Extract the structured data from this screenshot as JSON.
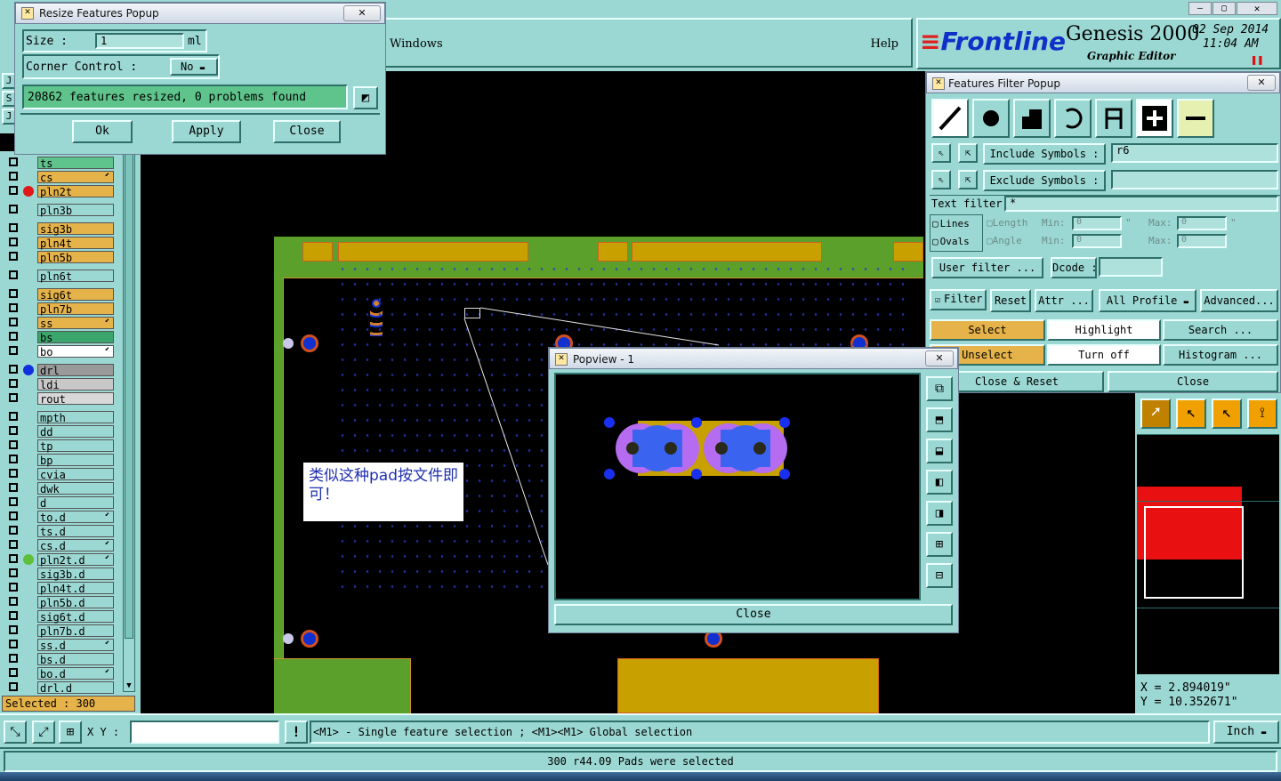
{
  "resize_popup": {
    "title": "Resize Features Popup",
    "size_label": "Size :",
    "size_value": "1",
    "size_unit": "ml",
    "corner_label": "Corner Control :",
    "corner_value": "No",
    "status": "20862 features resized, 0 problems found",
    "ok": "Ok",
    "apply": "Apply",
    "close": "Close"
  },
  "menu": {
    "windows": "Windows",
    "help": "Help"
  },
  "branding": {
    "logo": "Frontline",
    "product": "Genesis 2000",
    "subtitle": "Graphic Editor",
    "date": "02 Sep 2014",
    "time": "11:04 AM"
  },
  "filter_popup": {
    "title": "Features Filter Popup",
    "include_label": "Include Symbols :",
    "include_value": "r6",
    "exclude_label": "Exclude Symbols :",
    "exclude_value": "",
    "text_filter_label": "Text filter",
    "text_filter_value": "*",
    "lines": "Lines",
    "ovals": "Ovals",
    "length": "Length",
    "angle": "Angle",
    "min": "Min:",
    "max": "Max:",
    "len_min": "0",
    "len_max": "0",
    "ang_min": "0",
    "ang_max": "0",
    "quote": "\"",
    "user_filter": "User filter ...",
    "dcode": "Dcode :",
    "filter": "Filter",
    "reset": "Reset",
    "attr": "Attr ...",
    "all_profile": "All Profile",
    "advanced": "Advanced...",
    "select": "Select",
    "highlight": "Highlight",
    "search": "Search ...",
    "unselect": "Unselect",
    "turn_off": "Turn off",
    "histogram": "Histogram ...",
    "close_reset": "Close & Reset",
    "close": "Close"
  },
  "popview": {
    "title": "Popview - 1",
    "close": "Close"
  },
  "annotation": "类似这种pad按文件即可！",
  "layers": [
    {
      "name": "ts",
      "color": "#5fc48c",
      "dot": ""
    },
    {
      "name": "cs",
      "color": "#e6b34a",
      "dot": "",
      "arrow": true
    },
    {
      "name": "pln2t",
      "color": "#e6b34a",
      "dot": "#e01818"
    },
    {
      "name": "pln3b",
      "color": "#9bd8d3",
      "dot": ""
    },
    {
      "name": "sig3b",
      "color": "#e6b34a",
      "dot": ""
    },
    {
      "name": "pln4t",
      "color": "#e6b34a",
      "dot": ""
    },
    {
      "name": "pln5b",
      "color": "#e6b34a",
      "dot": ""
    },
    {
      "name": "pln6t",
      "color": "#9bd8d3",
      "dot": ""
    },
    {
      "name": "sig6t",
      "color": "#e6b34a",
      "dot": ""
    },
    {
      "name": "pln7b",
      "color": "#e6b34a",
      "dot": ""
    },
    {
      "name": "ss",
      "color": "#e6b34a",
      "dot": "",
      "arrow": true
    },
    {
      "name": "bs",
      "color": "#3aa66c",
      "dot": ""
    },
    {
      "name": "bo",
      "color": "#ffffff",
      "dot": "",
      "arrow": true
    },
    {
      "name": "drl",
      "color": "#9a9a9a",
      "dot": "#1030e0"
    },
    {
      "name": "ldi",
      "color": "#c8c8c8",
      "dot": ""
    },
    {
      "name": "rout",
      "color": "#d8d8d8",
      "dot": ""
    },
    {
      "name": "mpth",
      "color": "#9bd8d3",
      "dot": ""
    },
    {
      "name": "dd",
      "color": "#9bd8d3",
      "dot": ""
    },
    {
      "name": "tp",
      "color": "#9bd8d3",
      "dot": ""
    },
    {
      "name": "bp",
      "color": "#9bd8d3",
      "dot": ""
    },
    {
      "name": "cvia",
      "color": "#9bd8d3",
      "dot": ""
    },
    {
      "name": "dwk",
      "color": "#9bd8d3",
      "dot": ""
    },
    {
      "name": "d",
      "color": "#9bd8d3",
      "dot": ""
    },
    {
      "name": "to.d",
      "color": "#9bd8d3",
      "dot": "",
      "arrow": true
    },
    {
      "name": "ts.d",
      "color": "#9bd8d3",
      "dot": ""
    },
    {
      "name": "cs.d",
      "color": "#9bd8d3",
      "dot": "",
      "arrow": true
    },
    {
      "name": "pln2t.d",
      "color": "#9bd8d3",
      "dot": "#5fbf3a",
      "arrow": true
    },
    {
      "name": "sig3b.d",
      "color": "#9bd8d3",
      "dot": ""
    },
    {
      "name": "pln4t.d",
      "color": "#9bd8d3",
      "dot": ""
    },
    {
      "name": "pln5b.d",
      "color": "#9bd8d3",
      "dot": ""
    },
    {
      "name": "sig6t.d",
      "color": "#9bd8d3",
      "dot": ""
    },
    {
      "name": "pln7b.d",
      "color": "#9bd8d3",
      "dot": ""
    },
    {
      "name": "ss.d",
      "color": "#9bd8d3",
      "dot": "",
      "arrow": true
    },
    {
      "name": "bs.d",
      "color": "#9bd8d3",
      "dot": ""
    },
    {
      "name": "bo.d",
      "color": "#9bd8d3",
      "dot": "",
      "arrow": true
    },
    {
      "name": "drl.d",
      "color": "#9bd8d3",
      "dot": ""
    }
  ],
  "selected_count": "Selected : 300",
  "coords": {
    "x": "X = 2.894019\"",
    "y": "Y = 10.352671\""
  },
  "bottom": {
    "xy_label": "X Y :",
    "xy_value": "",
    "hint": "<M1> - Single feature selection ; <M1><M1> Global selection",
    "unit": "Inch",
    "status": "300 r44.09 Pads were selected"
  },
  "side_letters": [
    "J",
    "S",
    "J"
  ]
}
